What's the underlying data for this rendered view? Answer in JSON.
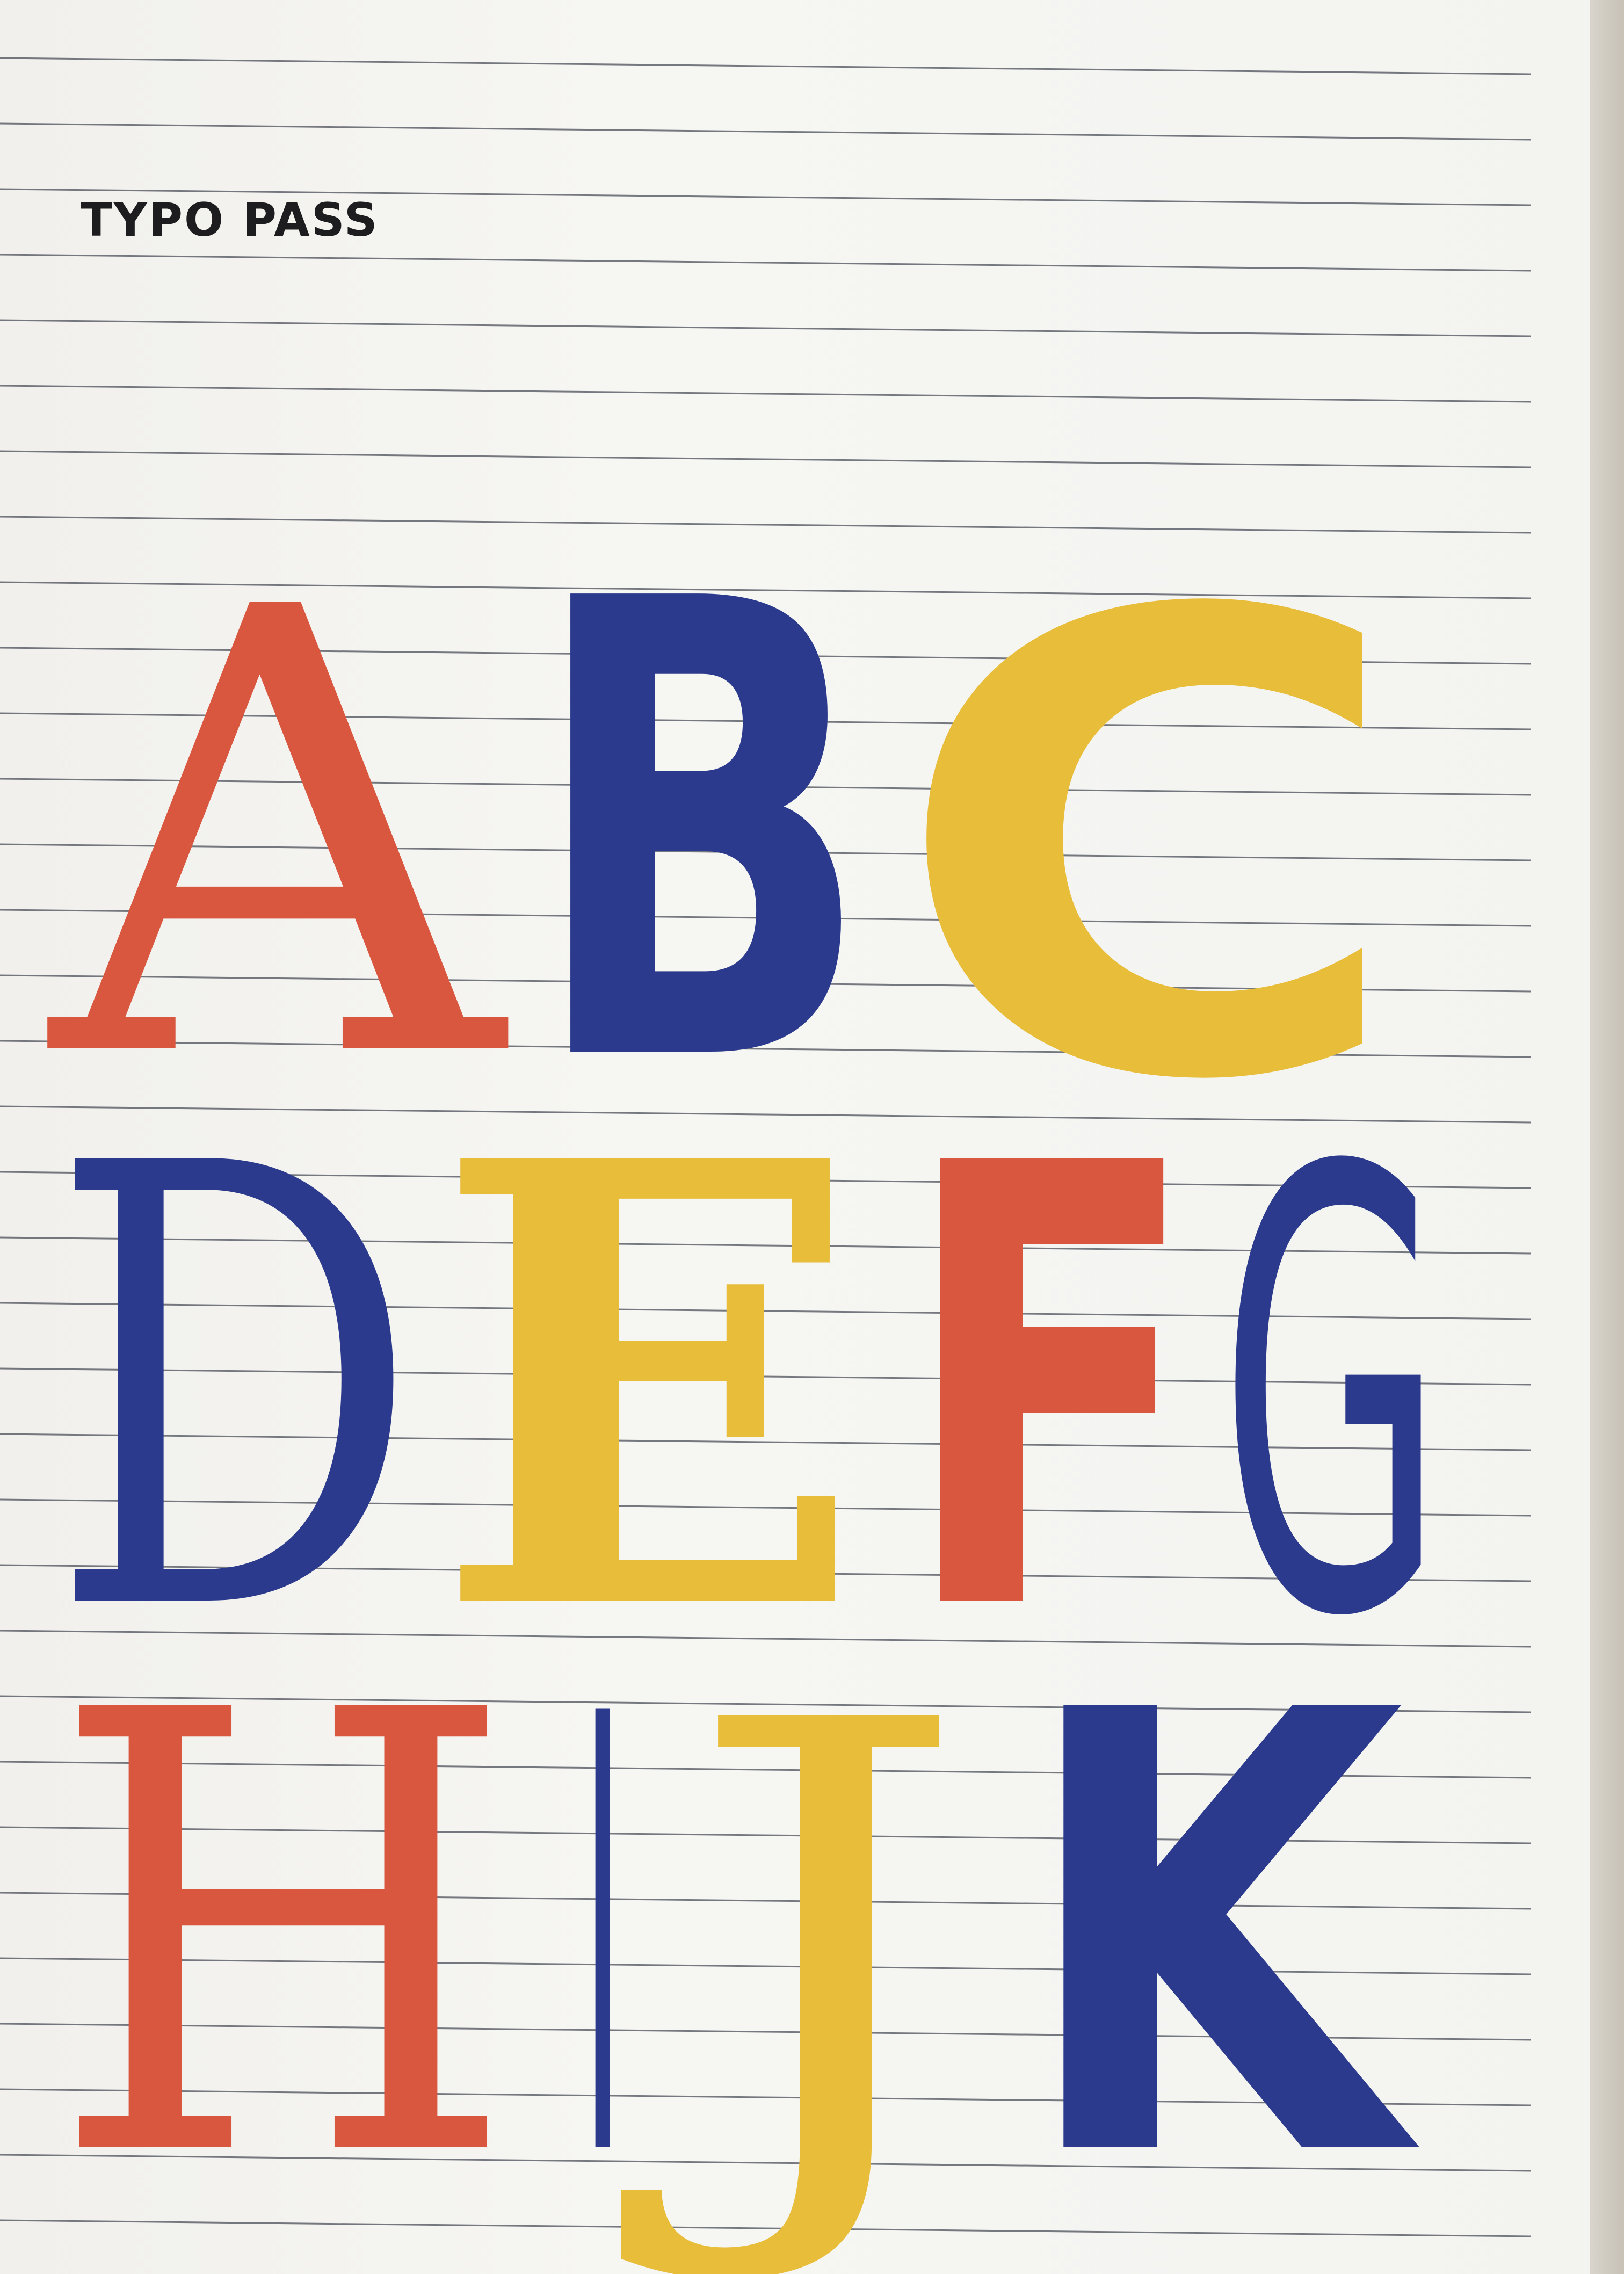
{
  "cover": {
    "title": "TYPO PASS"
  },
  "colors": {
    "paper": "#f4f4f1",
    "rule_line": "#4a4d58",
    "red": "#d9573f",
    "blue": "#2b3a8c",
    "yellow": "#e8bd3a",
    "title": "#1d1d1f"
  },
  "letters": {
    "row1": [
      "A",
      "B",
      "C"
    ],
    "row2": [
      "D",
      "E",
      "F",
      "G"
    ],
    "row3": [
      "H",
      "I",
      "J",
      "K"
    ]
  }
}
